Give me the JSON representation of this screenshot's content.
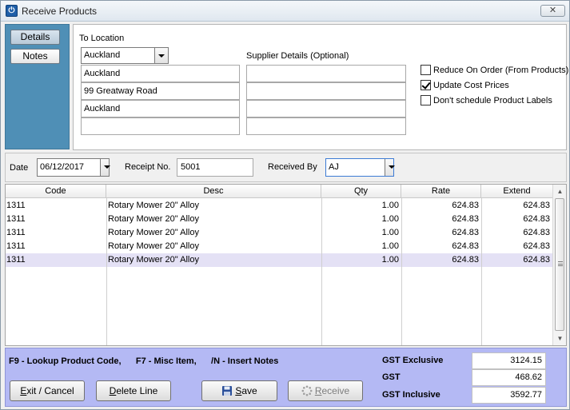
{
  "window": {
    "title": "Receive Products",
    "close_glyph": "✕",
    "app_icon": "power-icon"
  },
  "sidebar": {
    "items": [
      {
        "label": "Details",
        "active": true
      },
      {
        "label": "Notes",
        "active": false
      }
    ]
  },
  "location": {
    "label": "To Location",
    "selected": "Auckland",
    "lines": [
      "Auckland",
      "99 Greatway Road",
      "Auckland",
      ""
    ]
  },
  "supplier": {
    "label": "Supplier Details (Optional)",
    "lines": [
      "",
      "",
      "",
      ""
    ]
  },
  "options": [
    {
      "label": "Reduce On Order (From Products)",
      "checked": false
    },
    {
      "label": "Update Cost Prices",
      "checked": true
    },
    {
      "label": "Don't schedule Product Labels",
      "checked": false
    }
  ],
  "meta": {
    "date_label": "Date",
    "date": "06/12/2017",
    "receipt_label": "Receipt No.",
    "receipt_no": "5001",
    "received_by_label": "Received By",
    "received_by": "AJ"
  },
  "grid": {
    "headers": [
      "Code",
      "Desc",
      "Qty",
      "Rate",
      "Extend"
    ],
    "rows": [
      [
        "1311",
        "Rotary Mower 20\" Alloy",
        "1.00",
        "624.83",
        "624.83"
      ],
      [
        "1311",
        "Rotary Mower 20\" Alloy",
        "1.00",
        "624.83",
        "624.83"
      ],
      [
        "1311",
        "Rotary Mower 20\" Alloy",
        "1.00",
        "624.83",
        "624.83"
      ],
      [
        "1311",
        "Rotary Mower 20\" Alloy",
        "1.00",
        "624.83",
        "624.83"
      ],
      [
        "1311",
        "Rotary Mower 20\" Alloy",
        "1.00",
        "624.83",
        "624.83"
      ]
    ],
    "selected_row": 4
  },
  "footer": {
    "hint": "F9 - Lookup Product Code,      F7 - Misc Item,      /N - Insert Notes",
    "totals": [
      {
        "label": "GST Exclusive",
        "value": "3124.15"
      },
      {
        "label": "GST",
        "value": "468.62"
      },
      {
        "label": "GST Inclusive",
        "value": "3592.77"
      }
    ],
    "buttons": {
      "exit_u": "E",
      "exit_rest": "xit / Cancel",
      "delete_u": "D",
      "delete_rest": "elete Line",
      "save_u": "S",
      "save_rest": "ave",
      "receive_u": "R",
      "receive_rest": "eceive"
    }
  },
  "colors": {
    "sidebar": "#4f8fb6",
    "footer": "#b4b9f4",
    "selected_row": "#e4e1f5"
  }
}
